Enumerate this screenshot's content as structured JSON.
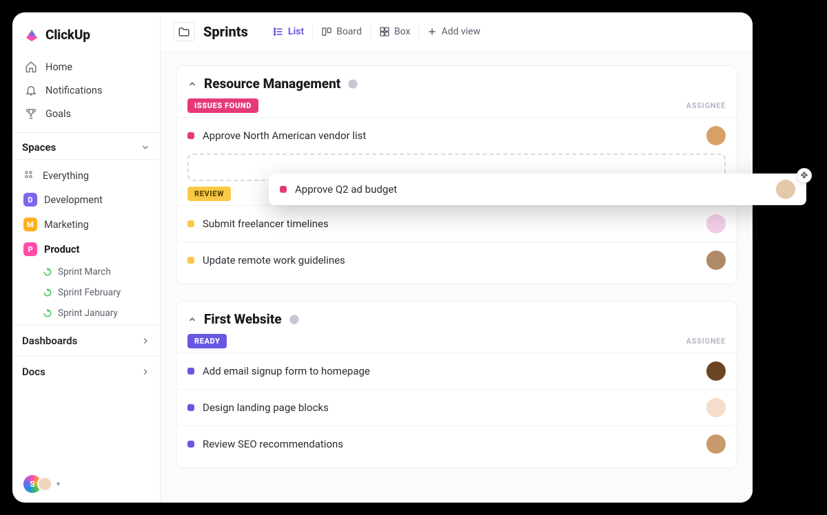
{
  "brand": {
    "name": "ClickUp"
  },
  "sidebar": {
    "nav": [
      {
        "label": "Home",
        "icon": "home-icon"
      },
      {
        "label": "Notifications",
        "icon": "bell-icon"
      },
      {
        "label": "Goals",
        "icon": "trophy-icon"
      }
    ],
    "spaces_header": "Spaces",
    "everything_label": "Everything",
    "spaces": [
      {
        "letter": "D",
        "label": "Development",
        "color": "d"
      },
      {
        "letter": "M",
        "label": "Marketing",
        "color": "m"
      },
      {
        "letter": "P",
        "label": "Product",
        "color": "p",
        "active": true
      }
    ],
    "sprints": [
      {
        "label": "Sprint  March"
      },
      {
        "label": "Sprint  February"
      },
      {
        "label": "Sprint January"
      }
    ],
    "bottom": [
      {
        "label": "Dashboards"
      },
      {
        "label": "Docs"
      }
    ],
    "user_initial": "S"
  },
  "topbar": {
    "title": "Sprints",
    "views": [
      {
        "label": "List",
        "active": true,
        "icon": "list-icon"
      },
      {
        "label": "Board",
        "active": false,
        "icon": "board-icon"
      },
      {
        "label": "Box",
        "active": false,
        "icon": "box-icon"
      }
    ],
    "add_view_label": "Add view"
  },
  "lists": [
    {
      "title": "Resource Management",
      "groups": [
        {
          "status_label": "ISSUES FOUND",
          "status_class": "pill-pink",
          "dot_class": "dot-pink",
          "assignee_header": "ASSIGNEE",
          "tasks": [
            {
              "title": "Approve North American vendor list",
              "avatar_class": "av1"
            }
          ],
          "has_dropzone": true
        },
        {
          "status_label": "REVIEW",
          "status_class": "pill-yellow",
          "dot_class": "dot-yellow",
          "assignee_header": "",
          "tasks": [
            {
              "title": "Submit freelancer timelines",
              "avatar_class": "av2"
            },
            {
              "title": "Update remote work guidelines",
              "avatar_class": "av3"
            }
          ]
        }
      ]
    },
    {
      "title": "First Website",
      "groups": [
        {
          "status_label": "READY",
          "status_class": "pill-purple",
          "dot_class": "dot-purple",
          "assignee_header": "ASSIGNEE",
          "tasks": [
            {
              "title": "Add email signup form to homepage",
              "avatar_class": "av4"
            },
            {
              "title": "Design landing page blocks",
              "avatar_class": "av5"
            },
            {
              "title": "Review SEO recommendations",
              "avatar_class": "av6"
            }
          ]
        }
      ]
    }
  ],
  "dragging_task": {
    "title": "Approve Q2 ad budget",
    "dot_class": "dot-pink",
    "avatar_class": "av7"
  }
}
